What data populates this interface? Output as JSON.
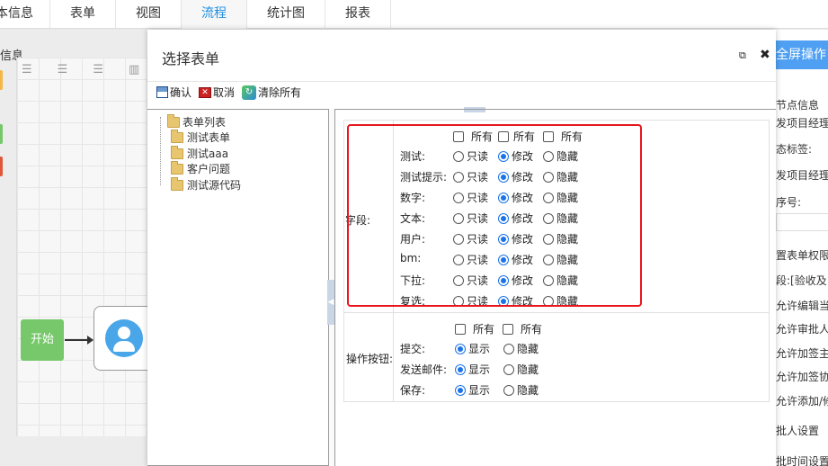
{
  "tabs": [
    "本信息",
    "表单",
    "视图",
    "流程",
    "统计图",
    "报表"
  ],
  "active_tab_index": 3,
  "background": {
    "left_info": "信息",
    "start_node": "开始",
    "fullscreen_btn": "全屏操作",
    "right_lines": [
      "节点信息",
      "发项目经理",
      "态标签:",
      "发项目经理",
      "序号:",
      "置表单权限",
      "段:[验收及",
      "允许编辑当",
      "允许审批人",
      "允许加签主",
      "允许加签协",
      "允许添加/修",
      "批人设置",
      "批时间设置"
    ]
  },
  "modal": {
    "title": "选择表单",
    "toolbar": {
      "confirm": "确认",
      "cancel": "取消",
      "clear_all": "清除所有"
    },
    "tree": {
      "root": "表单列表",
      "children": [
        "测试表单",
        "测试aaa",
        "客户问题",
        "测试源代码"
      ]
    },
    "fields_section": {
      "label": "字段:",
      "header_all": [
        "所有",
        "所有",
        "所有"
      ],
      "options": [
        "只读",
        "修改",
        "隐藏"
      ],
      "rows": [
        {
          "name": "测试:",
          "selected": "修改"
        },
        {
          "name": "测试提示:",
          "selected": "修改"
        },
        {
          "name": "数字:",
          "selected": "修改"
        },
        {
          "name": "文本:",
          "selected": "修改"
        },
        {
          "name": "用户:",
          "selected": "修改"
        },
        {
          "name": "bm:",
          "selected": "修改"
        },
        {
          "name": "下拉:",
          "selected": "修改"
        },
        {
          "name": "复选:",
          "selected": "修改"
        }
      ]
    },
    "buttons_section": {
      "label": "操作按钮:",
      "header_all": [
        "所有",
        "所有"
      ],
      "options": [
        "显示",
        "隐藏"
      ],
      "rows": [
        {
          "name": "提交:",
          "selected": "显示"
        },
        {
          "name": "发送邮件:",
          "selected": "显示"
        },
        {
          "name": "保存:",
          "selected": "显示"
        }
      ]
    }
  }
}
